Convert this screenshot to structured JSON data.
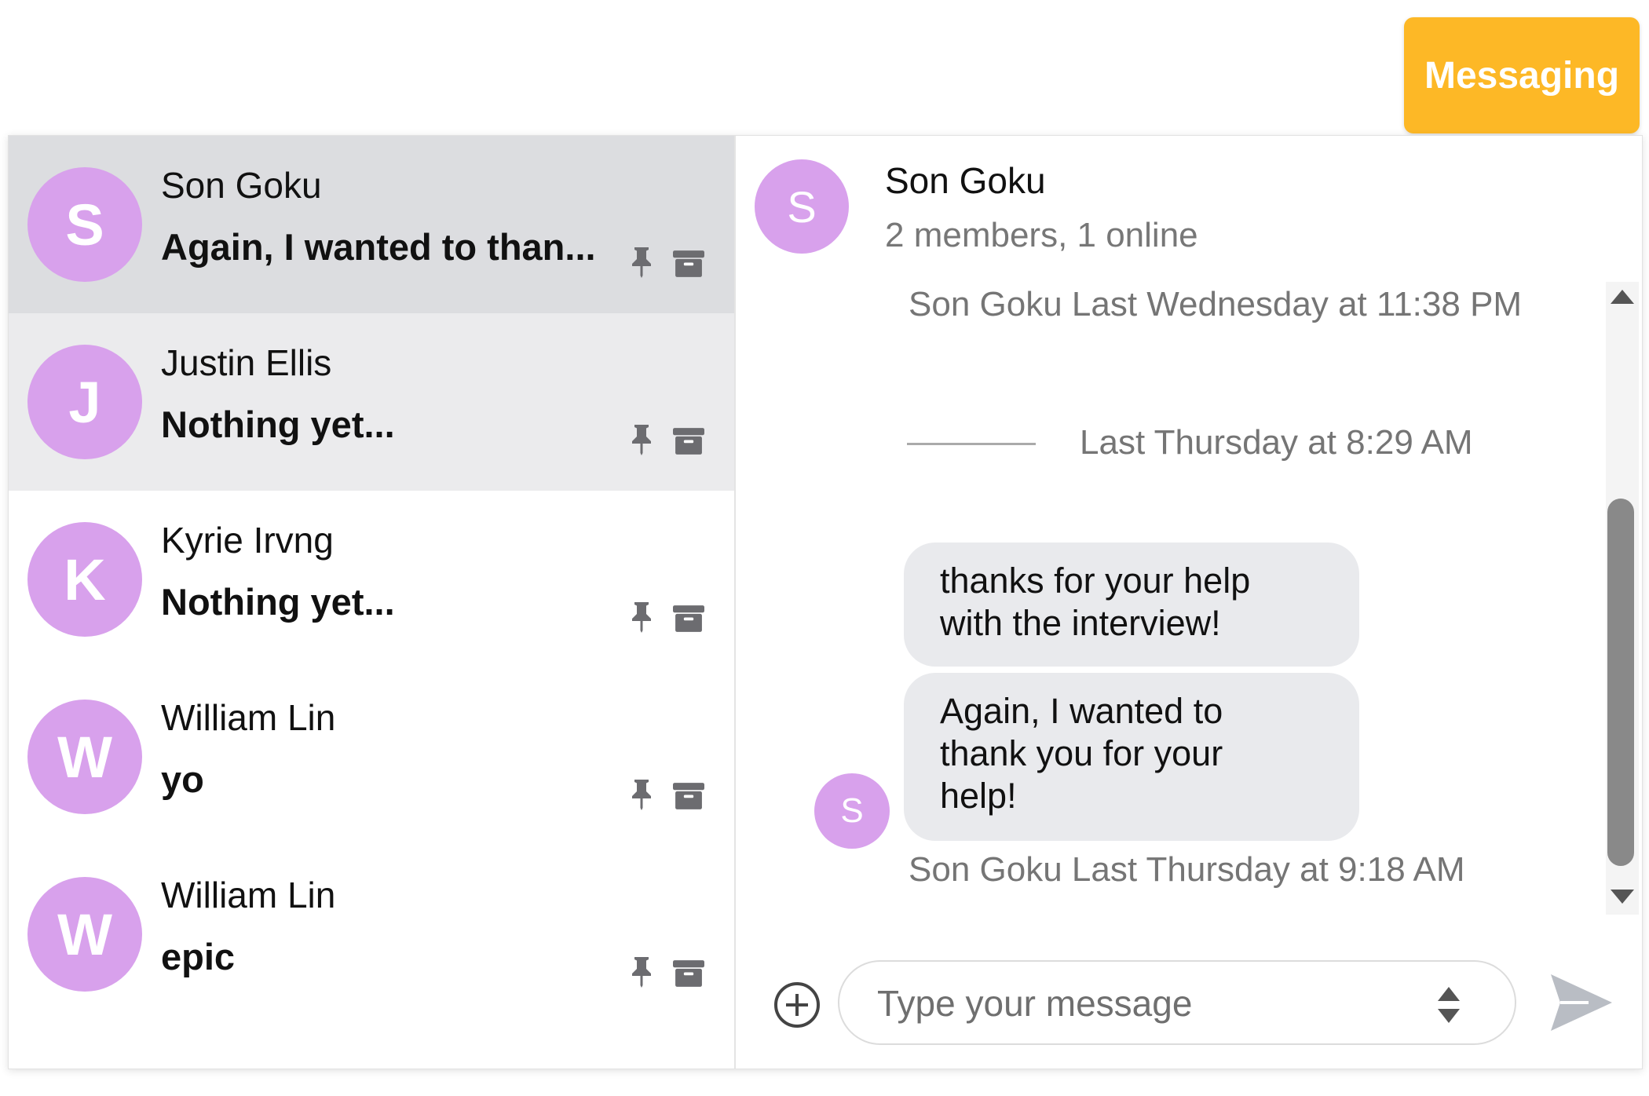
{
  "header": {
    "messaging_label": "Messaging"
  },
  "conversations": [
    {
      "initial": "S",
      "name": "Son Goku",
      "preview": "Again, I wanted to than..."
    },
    {
      "initial": "J",
      "name": "Justin Ellis",
      "preview": "Nothing yet..."
    },
    {
      "initial": "K",
      "name": "Kyrie Irvng",
      "preview": "Nothing yet..."
    },
    {
      "initial": "W",
      "name": "William Lin",
      "preview": "yo"
    },
    {
      "initial": "W",
      "name": "William Lin",
      "preview": "epic"
    }
  ],
  "chat": {
    "initial": "S",
    "title": "Son Goku",
    "subtitle": "2 members, 1 online",
    "meta_top": "Son Goku Last Wednesday at 11:38 PM",
    "date_separator": "Last Thursday at 8:29 AM",
    "messages": [
      {
        "text_line1": "thanks for your help",
        "text_line2": "with the interview!"
      },
      {
        "text_line1": "Again, I wanted to",
        "text_line2": "thank you for your",
        "text_line3": "help!"
      }
    ],
    "message_avatar_initial": "S",
    "meta_bottom": "Son Goku Last Thursday at 9:18 AM"
  },
  "composer": {
    "placeholder": "Type your message"
  },
  "colors": {
    "accent": "#fdb826",
    "avatar": "#d8a1ec",
    "active_row": "#dcdde0",
    "bubble": "#e9eaed"
  },
  "icons": [
    "pin-icon",
    "archive-icon",
    "add-circle-icon",
    "send-icon",
    "spinner-icon",
    "chevron-up-icon",
    "chevron-down-icon"
  ]
}
